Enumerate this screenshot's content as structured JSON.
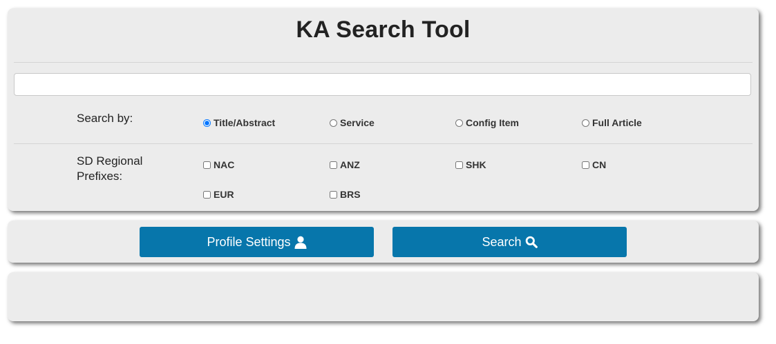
{
  "header": {
    "title": "KA Search Tool"
  },
  "search": {
    "value": "",
    "placeholder": ""
  },
  "search_by": {
    "label": "Search by:",
    "options": [
      {
        "label": "Title/Abstract",
        "checked": true
      },
      {
        "label": "Service",
        "checked": false
      },
      {
        "label": "Config Item",
        "checked": false
      },
      {
        "label": "Full Article",
        "checked": false
      }
    ]
  },
  "prefixes": {
    "label": "SD Regional Prefixes:",
    "options": [
      {
        "label": "NAC",
        "checked": false
      },
      {
        "label": "ANZ",
        "checked": false
      },
      {
        "label": "SHK",
        "checked": false
      },
      {
        "label": "CN",
        "checked": false
      },
      {
        "label": "EUR",
        "checked": false
      },
      {
        "label": "BRS",
        "checked": false
      }
    ]
  },
  "buttons": {
    "profile_label": "Profile Settings",
    "profile_icon": "user-icon",
    "search_label": "Search",
    "search_icon": "search-icon",
    "color": "#0776ab"
  }
}
